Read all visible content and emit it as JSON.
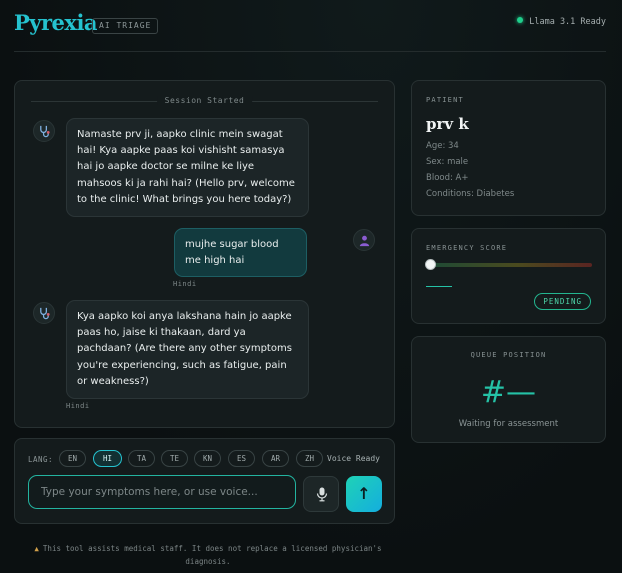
{
  "header": {
    "logo": "Pyrexia",
    "badge": "AI TRIAGE",
    "status": "Llama 3.1 Ready"
  },
  "chat": {
    "session_label": "Session Started",
    "messages": [
      {
        "role": "assistant",
        "text": "Namaste prv ji, aapko clinic mein swagat hai! Kya aapke paas koi vishisht samasya hai jo aapke doctor se milne ke liye mahsoos ki ja rahi hai? (Hello prv, welcome to the clinic! What brings you here today?)"
      },
      {
        "role": "user",
        "text": "mujhe sugar blood me high hai",
        "lang": "Hindi"
      },
      {
        "role": "assistant",
        "text": "Kya aapko koi anya lakshana hain jo aapke paas ho, jaise ki thakaan, dard ya pachdaan? (Are there any other symptoms you're experiencing, such as fatigue, pain or weakness?)",
        "lang": "Hindi"
      }
    ]
  },
  "input": {
    "lang_label": "LANG:",
    "languages": [
      "EN",
      "HI",
      "TA",
      "TE",
      "KN",
      "ES",
      "AR",
      "ZH"
    ],
    "active_language": "HI",
    "voice_status": "Voice Ready",
    "placeholder": "Type your symptoms here, or use voice...",
    "value": "",
    "send_label": "↑"
  },
  "disclaimer": "This tool assists medical staff. It does not replace a licensed physician's diagnosis.",
  "patient": {
    "label": "PATIENT",
    "name": "prv k",
    "age": "Age: 34",
    "sex": "Sex: male",
    "blood": "Blood: A+",
    "conditions": "Conditions: Diabetes"
  },
  "emergency": {
    "label": "EMERGENCY SCORE",
    "score_fraction": 0,
    "status": "PENDING"
  },
  "queue": {
    "label": "QUEUE POSITION",
    "number": "#—",
    "subtitle": "Waiting for assessment"
  },
  "colors": {
    "accent": "#25c2cf",
    "ready": "#1fcf8c",
    "pending": "#23b58f"
  }
}
